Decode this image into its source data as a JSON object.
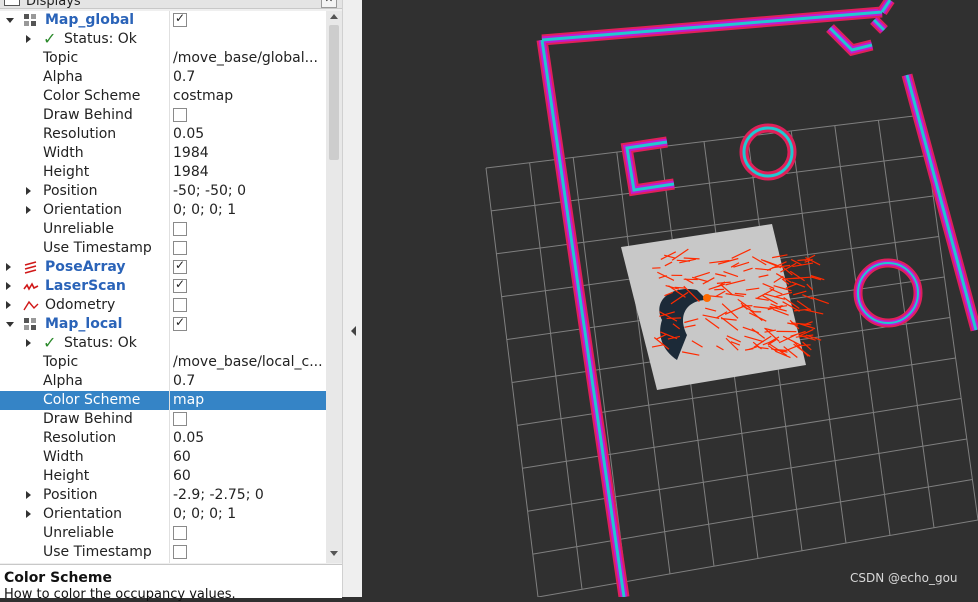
{
  "panel": {
    "title": "Displays"
  },
  "tree": [
    {
      "type": "display",
      "indent": 0,
      "arrow": "d",
      "icon": "grid-icon",
      "label": "Map_global",
      "check": true
    },
    {
      "type": "status",
      "indent": 1,
      "arrow": "r",
      "label": "Status: Ok"
    },
    {
      "type": "prop",
      "indent": 1,
      "label": "Topic",
      "value": "/move_base/global..."
    },
    {
      "type": "prop",
      "indent": 1,
      "label": "Alpha",
      "value": "0.7"
    },
    {
      "type": "prop",
      "indent": 1,
      "label": "Color Scheme",
      "value": "costmap"
    },
    {
      "type": "prop",
      "indent": 1,
      "label": "Draw Behind",
      "check": false
    },
    {
      "type": "prop",
      "indent": 1,
      "label": "Resolution",
      "value": "0.05"
    },
    {
      "type": "prop",
      "indent": 1,
      "label": "Width",
      "value": "1984"
    },
    {
      "type": "prop",
      "indent": 1,
      "label": "Height",
      "value": "1984"
    },
    {
      "type": "prop",
      "indent": 1,
      "arrow": "r",
      "label": "Position",
      "value": "-50; -50; 0"
    },
    {
      "type": "prop",
      "indent": 1,
      "arrow": "r",
      "label": "Orientation",
      "value": "0; 0; 0; 1"
    },
    {
      "type": "prop",
      "indent": 1,
      "label": "Unreliable",
      "check": false
    },
    {
      "type": "prop",
      "indent": 1,
      "label": "Use Timestamp",
      "check": false
    },
    {
      "type": "display",
      "indent": 0,
      "arrow": "r",
      "icon": "pose-array-icon",
      "label": "PoseArray",
      "check": true
    },
    {
      "type": "display",
      "indent": 0,
      "arrow": "r",
      "icon": "laser-scan-icon",
      "label": "LaserScan",
      "check": true
    },
    {
      "type": "plain",
      "indent": 0,
      "arrow": "r",
      "icon": "odometry-icon",
      "label": "Odometry",
      "check": false
    },
    {
      "type": "display",
      "indent": 0,
      "arrow": "d",
      "icon": "grid-icon",
      "label": "Map_local",
      "check": true
    },
    {
      "type": "status",
      "indent": 1,
      "arrow": "r",
      "label": "Status: Ok"
    },
    {
      "type": "prop",
      "indent": 1,
      "label": "Topic",
      "value": "/move_base/local_c..."
    },
    {
      "type": "prop",
      "indent": 1,
      "label": "Alpha",
      "value": "0.7"
    },
    {
      "type": "prop",
      "indent": 1,
      "label": "Color Scheme",
      "value": "map",
      "selected": true
    },
    {
      "type": "prop",
      "indent": 1,
      "label": "Draw Behind",
      "check": false
    },
    {
      "type": "prop",
      "indent": 1,
      "label": "Resolution",
      "value": "0.05"
    },
    {
      "type": "prop",
      "indent": 1,
      "label": "Width",
      "value": "60"
    },
    {
      "type": "prop",
      "indent": 1,
      "label": "Height",
      "value": "60"
    },
    {
      "type": "prop",
      "indent": 1,
      "arrow": "r",
      "label": "Position",
      "value": "-2.9; -2.75; 0"
    },
    {
      "type": "prop",
      "indent": 1,
      "arrow": "r",
      "label": "Orientation",
      "value": "0; 0; 0; 1"
    },
    {
      "type": "prop",
      "indent": 1,
      "label": "Unreliable",
      "check": false
    },
    {
      "type": "prop",
      "indent": 1,
      "label": "Use Timestamp",
      "check": false
    }
  ],
  "description": {
    "title": "Color Scheme",
    "text": "How to color the occupancy values."
  },
  "watermark": "CSDN @echo_gou",
  "colors": {
    "selection": "#3584c6",
    "costmap_outer": "#e0205a",
    "costmap_mid": "#c21ad0",
    "costmap_inner": "#20c8d0",
    "laser": "#ff2a00",
    "local_map": "#c8c8c8"
  }
}
